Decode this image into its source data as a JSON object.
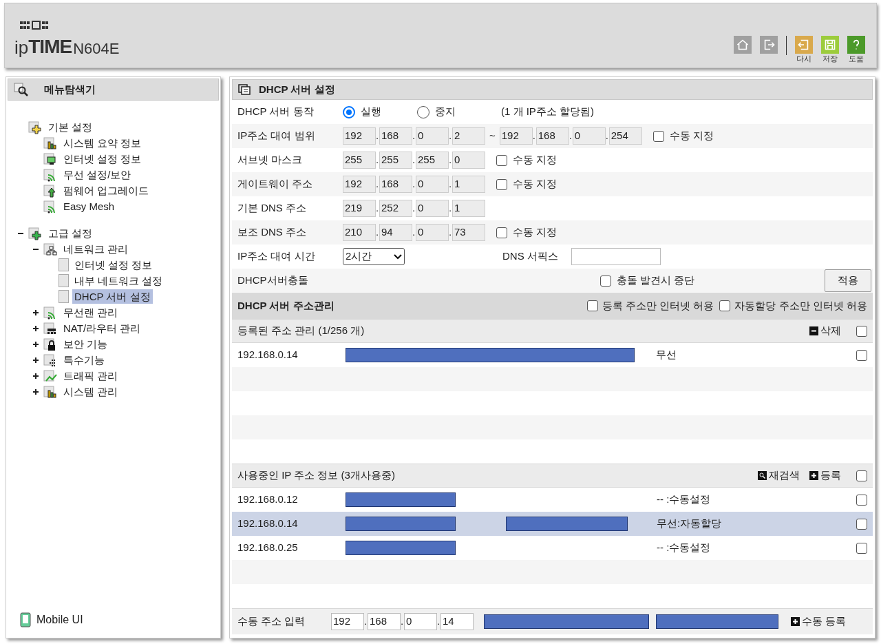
{
  "header": {
    "logo_prefix": "ip",
    "logo_main": "TIME",
    "model": "N604E",
    "buttons": [
      {
        "kind": "home"
      },
      {
        "kind": "logout"
      },
      {
        "kind": "undo",
        "label": "다시"
      },
      {
        "kind": "save",
        "label": "저장"
      },
      {
        "kind": "help",
        "label": "도움"
      }
    ]
  },
  "sidebar": {
    "title": "메뉴탐색기",
    "tree": [
      {
        "label": "기본 설정",
        "kind": "basic-folder",
        "selected": false,
        "children": [
          {
            "label": "시스템 요약 정보",
            "kind": "chart",
            "selected": false
          },
          {
            "label": "인터넷 설정 정보",
            "kind": "monitor",
            "selected": false
          },
          {
            "label": "무선 설정/보안",
            "kind": "wifi",
            "selected": false
          },
          {
            "label": "펌웨어 업그레이드",
            "kind": "upload",
            "selected": false
          },
          {
            "label": "Easy Mesh",
            "kind": "wifi",
            "selected": false
          }
        ]
      },
      {
        "label": "고급 설정",
        "kind": "advanced-folder",
        "selected": false,
        "expanded": true,
        "children": [
          {
            "label": "네트워크 관리",
            "kind": "network",
            "selected": false,
            "expanded": true,
            "children": [
              {
                "label": "인터넷 설정 정보",
                "kind": "page",
                "selected": false
              },
              {
                "label": "내부 네트워크 설정",
                "kind": "page",
                "selected": false
              },
              {
                "label": "DHCP 서버 설정",
                "kind": "page",
                "selected": true
              }
            ]
          },
          {
            "label": "무선랜 관리",
            "kind": "wifi",
            "selected": false,
            "expanded": false
          },
          {
            "label": "NAT/라우터 관리",
            "kind": "router",
            "selected": false,
            "expanded": false
          },
          {
            "label": "보안 기능",
            "kind": "lock",
            "selected": false,
            "expanded": false
          },
          {
            "label": "특수기능",
            "kind": "dots",
            "selected": false,
            "expanded": false
          },
          {
            "label": "트래픽 관리",
            "kind": "traffic",
            "selected": false,
            "expanded": false
          },
          {
            "label": "시스템 관리",
            "kind": "chart",
            "selected": false,
            "expanded": false
          }
        ]
      }
    ],
    "footer": "Mobile UI"
  },
  "main": {
    "title": "DHCP 서버 설정",
    "rows": [
      {
        "kind": "radio",
        "label": "DHCP 서버 동작",
        "options": [
          {
            "label": "실행",
            "selected": true
          },
          {
            "label": "중지",
            "selected": false
          }
        ],
        "note": "(1 개 IP주소 할당됨)"
      },
      {
        "kind": "range",
        "label": "IP주소 대여 범위",
        "octets": [
          "192",
          "168",
          "0",
          "2"
        ],
        "tilde": "~",
        "to": [
          "192",
          "168",
          "0",
          "254"
        ],
        "separator": ".",
        "check": {
          "label": "수동 지정",
          "checked": false
        }
      },
      {
        "kind": "ip",
        "label": "서브넷 마스크",
        "octets": [
          "255",
          "255",
          "255",
          "0"
        ],
        "separator": ".",
        "check": {
          "label": "수동 지정",
          "checked": false
        }
      },
      {
        "kind": "ip",
        "label": "게이트웨이 주소",
        "octets": [
          "192",
          "168",
          "0",
          "1"
        ],
        "separator": ".",
        "check": {
          "label": "수동 지정",
          "checked": false
        }
      },
      {
        "kind": "ip",
        "label": "기본 DNS 주소",
        "octets": [
          "219",
          "252",
          "0",
          "1"
        ],
        "separator": "."
      },
      {
        "kind": "ip",
        "label": "보조 DNS 주소",
        "octets": [
          "210",
          "94",
          "0",
          "73"
        ],
        "separator": ".",
        "check": {
          "label": "수동 지정",
          "checked": false
        }
      },
      {
        "kind": "lease",
        "label": "IP주소 대여 시간",
        "select": "2시간",
        "suffix_label": "DNS 서픽스"
      },
      {
        "kind": "conflict",
        "label": "DHCP서버충돌",
        "check": {
          "label": "충돌 발견시 중단",
          "checked": false
        },
        "button": "적용"
      }
    ],
    "section": {
      "title": "DHCP 서버 주소관리",
      "checks": [
        {
          "label": "등록 주소만 인터넷 허용",
          "checked": false
        },
        {
          "label": "자동할당 주소만 인터넷 허용",
          "checked": false
        }
      ]
    },
    "registered": {
      "title": "등록된 주소 관리 (1/256 개)",
      "actions": [
        {
          "kind": "remove",
          "label": "삭제"
        }
      ],
      "all_checked": false,
      "rows": [
        {
          "ip": "192.168.0.14",
          "masked": [
            true
          ],
          "type": "무선",
          "checked": false,
          "selected": false
        }
      ]
    },
    "in_use": {
      "title": "사용중인 IP 주소 정보 (3개사용중)",
      "actions": [
        {
          "kind": "search",
          "label": "재검색"
        },
        {
          "kind": "add",
          "label": "등록"
        }
      ],
      "all_checked": false,
      "rows": [
        {
          "ip": "192.168.0.12",
          "masked": [
            true,
            false
          ],
          "type": "-- :수동설정",
          "checked": false,
          "selected": false
        },
        {
          "ip": "192.168.0.14",
          "masked": [
            true,
            true
          ],
          "type": "무선:자동할당",
          "checked": false,
          "selected": true
        },
        {
          "ip": "192.168.0.25",
          "masked": [
            true,
            false
          ],
          "type": "-- :수동설정",
          "checked": false,
          "selected": false
        }
      ]
    },
    "manual": {
      "label": "수동 주소 입력",
      "octets": [
        "192",
        "168",
        "0",
        "14"
      ],
      "separator": ".",
      "masked": [
        true,
        true
      ],
      "button": "수동 등록"
    }
  }
}
